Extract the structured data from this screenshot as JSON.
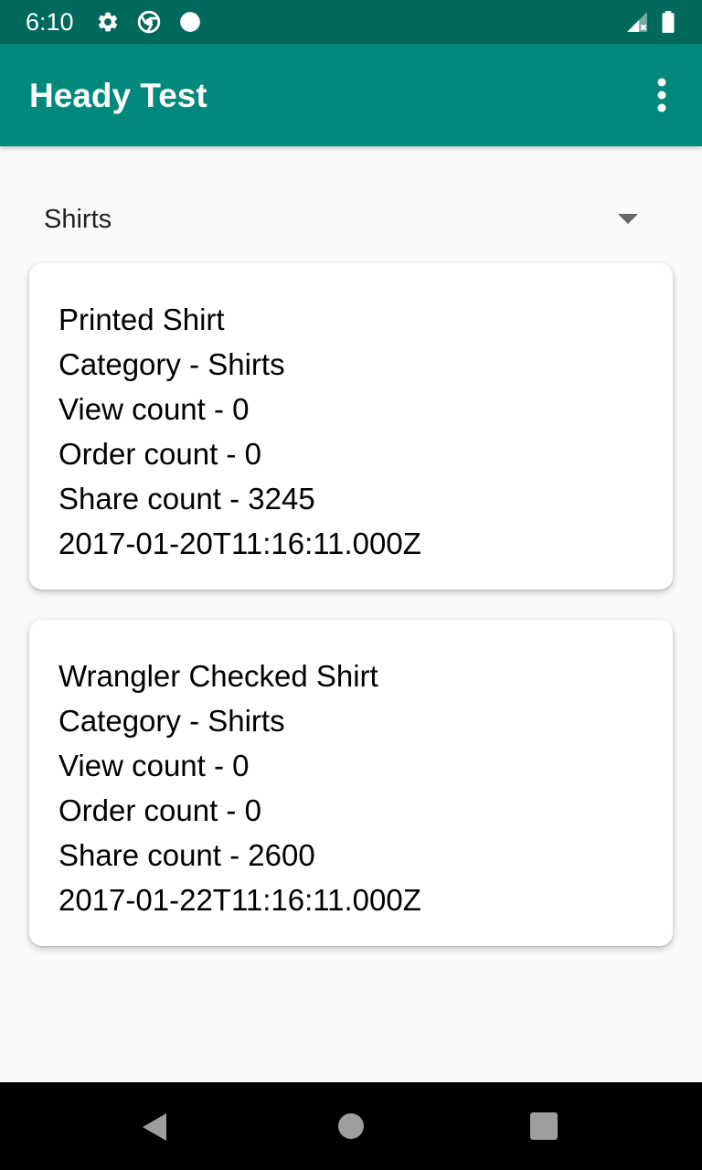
{
  "status_bar": {
    "time": "6:10",
    "icons": [
      "settings-icon",
      "chrome-icon",
      "dot-icon",
      "signal-icon",
      "battery-icon"
    ]
  },
  "app_bar": {
    "title": "Heady Test",
    "overflow_icon": "more-vert-icon"
  },
  "category_spinner": {
    "selected": "Shirts"
  },
  "products": [
    {
      "name": "Printed Shirt",
      "category": "Category - Shirts",
      "view_count": "View count - 0",
      "order_count": "Order count - 0",
      "share_count": "Share count - 3245",
      "date": "2017-01-20T11:16:11.000Z"
    },
    {
      "name": "Wrangler Checked Shirt",
      "category": "Category - Shirts",
      "view_count": "View count - 0",
      "order_count": "Order count - 0",
      "share_count": "Share count - 2600",
      "date": "2017-01-22T11:16:11.000Z"
    }
  ],
  "nav_bar": {
    "buttons": [
      "back-icon",
      "home-icon",
      "recents-icon"
    ]
  },
  "colors": {
    "status_bar": "#00695c",
    "app_bar": "#00897b",
    "background": "#fafafa"
  }
}
